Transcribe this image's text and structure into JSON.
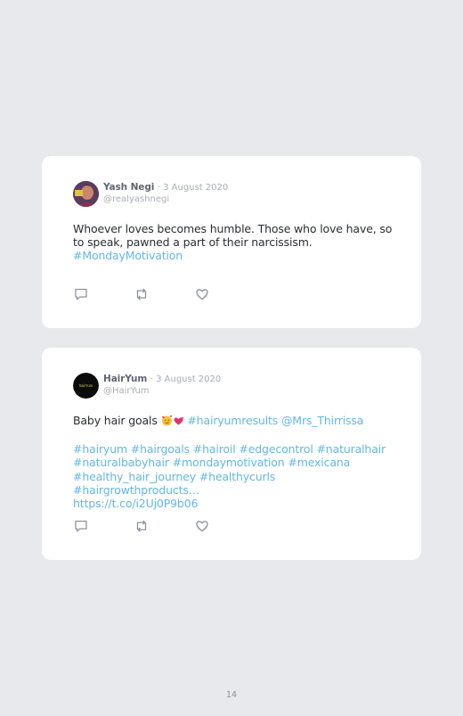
{
  "tweets": [
    {
      "author": "Yash Negi",
      "separator": "·",
      "date": "3 August 2020",
      "handle": "@realyashnegi",
      "text": "Whoever loves becomes humble. Those who love have, so to speak, pawned a part of their narcissism.",
      "hashtag": "#MondayMotivation"
    },
    {
      "author": "HairYum",
      "separator": "·",
      "date": "3 August 2020",
      "handle": "@HairYum",
      "avatar_text": "hairYum",
      "text": "Baby hair goals",
      "emoji": [
        "smiling-face-with-hearts",
        "two-hearts"
      ],
      "inline_links": "#hairyumresults @Mrs_Thirrissa",
      "hashtags_line1": "#hairyum #hairgoals #hairoil #edgecontrol #naturalhair",
      "hashtags_line2": "#naturalbabyhair #mondaymotivation #mexicana",
      "hashtags_line3": "#healthy_hair_journey #healthycurls #hairgrowthproducts…",
      "link": "https://t.co/i2Uj0P9b06"
    }
  ],
  "actions": {
    "icons": [
      "reply-icon",
      "retweet-icon",
      "like-icon"
    ],
    "color": "#8e939c"
  },
  "page_number": "14",
  "colors": {
    "background": "#e8e9ed",
    "card": "#ffffff",
    "link": "#62b7e6",
    "author": "#5f6672",
    "muted": "#a9adb5"
  }
}
